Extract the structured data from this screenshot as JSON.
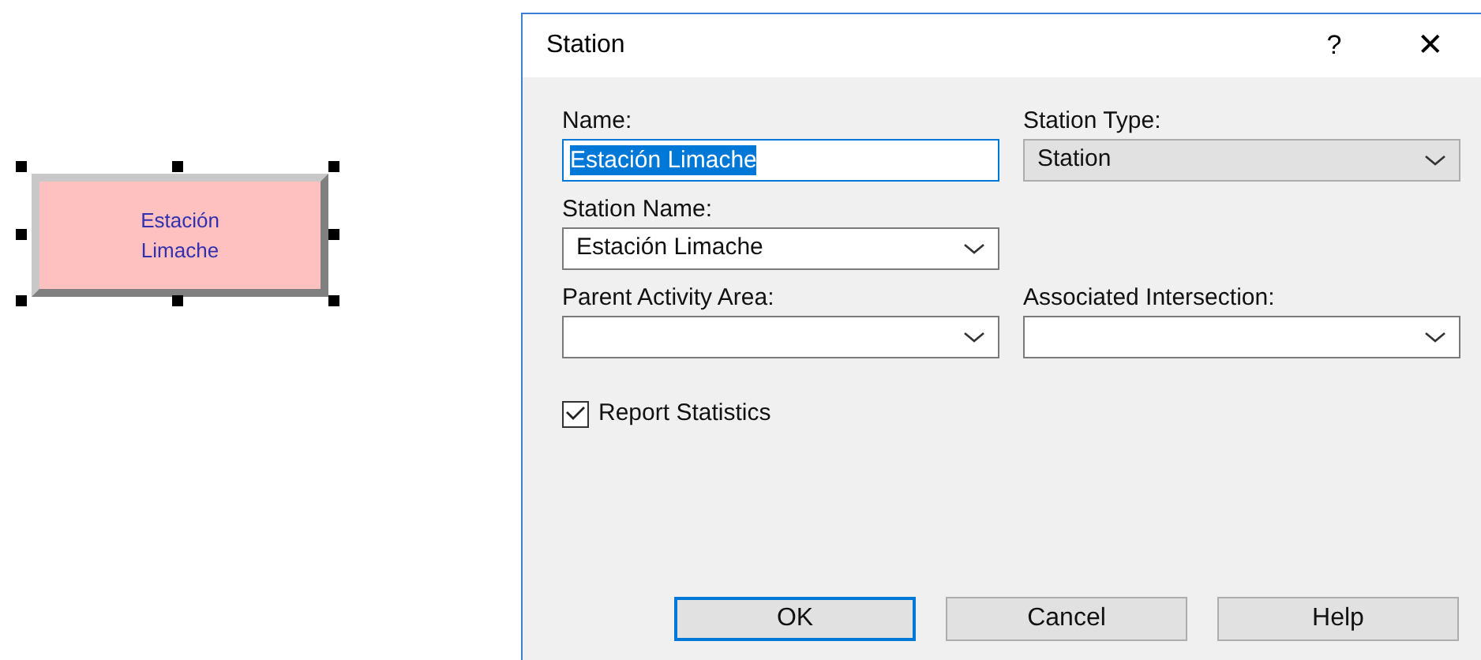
{
  "canvas": {
    "block": {
      "label_lines": [
        "Estación",
        "Limache"
      ],
      "selected": true
    }
  },
  "dialog": {
    "title": "Station",
    "help_button": "?",
    "close_button": "✕",
    "fields": [
      {
        "label": "Name:",
        "kind": "text",
        "value": "Estación Limache",
        "text_selected": true
      },
      {
        "label": "Station Type:",
        "kind": "dropdown_list",
        "value": "Station"
      },
      {
        "label": "Station Name:",
        "kind": "combo",
        "value": "Estación Limache"
      },
      {
        "kind": "spacer"
      },
      {
        "label": "Parent Activity Area:",
        "kind": "combo"
      },
      {
        "label": "Associated Intersection:",
        "kind": "combo"
      }
    ],
    "checkbox": {
      "label": "Report Statistics",
      "checked": true
    },
    "buttons": [
      {
        "label": "OK",
        "default": true
      },
      {
        "label": "Cancel",
        "default": false
      },
      {
        "label": "Help",
        "default": false
      }
    ]
  }
}
